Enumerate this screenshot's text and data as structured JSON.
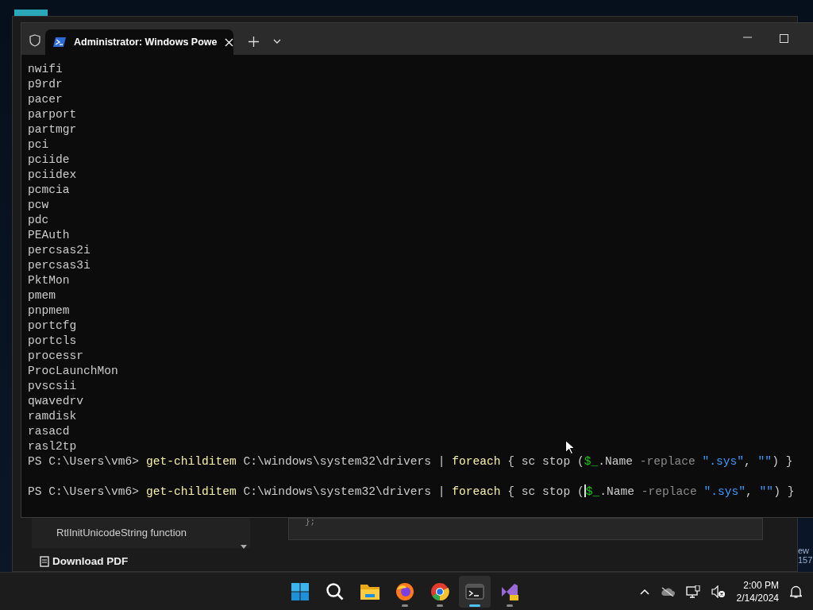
{
  "background_page": {
    "toc_item": "RtlInitUnicodeString function",
    "download_pdf": "Download PDF",
    "code_fragment": "};",
    "edge_texts": [
      "ew",
      "157"
    ]
  },
  "terminal": {
    "tabs": [
      {
        "title": "Administrator: Windows Powe",
        "selected": true
      }
    ],
    "output_lines": [
      "nwifi",
      "p9rdr",
      "pacer",
      "parport",
      "partmgr",
      "pci",
      "pciide",
      "pciidex",
      "pcmcia",
      "pcw",
      "pdc",
      "PEAuth",
      "percsas2i",
      "percsas3i",
      "PktMon",
      "pmem",
      "pnpmem",
      "portcfg",
      "portcls",
      "processr",
      "ProcLaunchMon",
      "pvscsii",
      "qwavedrv",
      "ramdisk",
      "rasacd",
      "rasl2tp"
    ],
    "prompts": [
      {
        "segments": [
          {
            "kind": "plain",
            "text": "PS C:\\Users\\vm6> "
          },
          {
            "kind": "command",
            "text": "get-childitem"
          },
          {
            "kind": "plain",
            "text": " C:\\windows\\system32\\drivers | "
          },
          {
            "kind": "command",
            "text": "foreach"
          },
          {
            "kind": "plain",
            "text": " { sc stop ("
          },
          {
            "kind": "variable",
            "text": "$_"
          },
          {
            "kind": "plain",
            "text": ".Name "
          },
          {
            "kind": "operator",
            "text": "-replace "
          },
          {
            "kind": "string",
            "text": "\".sys\""
          },
          {
            "kind": "plain",
            "text": ", "
          },
          {
            "kind": "string",
            "text": "\"\""
          },
          {
            "kind": "plain",
            "text": ") }"
          }
        ]
      },
      {
        "segments": [
          {
            "kind": "plain",
            "text": "PS C:\\Users\\vm6> "
          },
          {
            "kind": "command",
            "text": "get-childitem"
          },
          {
            "kind": "plain",
            "text": " C:\\windows\\system32\\drivers | "
          },
          {
            "kind": "command",
            "text": "foreach"
          },
          {
            "kind": "plain",
            "text": " { sc stop ("
          },
          {
            "kind": "cursor"
          },
          {
            "kind": "variable",
            "text": "$_"
          },
          {
            "kind": "plain",
            "text": ".Name "
          },
          {
            "kind": "operator",
            "text": "-replace "
          },
          {
            "kind": "string",
            "text": "\".sys\""
          },
          {
            "kind": "plain",
            "text": ", "
          },
          {
            "kind": "string",
            "text": "\"\""
          },
          {
            "kind": "plain",
            "text": ") }"
          }
        ]
      }
    ]
  },
  "taskbar": {
    "apps": [
      {
        "kind": "start",
        "active": false
      },
      {
        "kind": "search",
        "active": false
      },
      {
        "kind": "explorer",
        "active": false
      },
      {
        "kind": "firefox",
        "active": false
      },
      {
        "kind": "chrome",
        "active": false
      },
      {
        "kind": "terminal",
        "active": true
      },
      {
        "kind": "vs",
        "active": false
      }
    ],
    "clock": {
      "time": "2:00 PM",
      "date": "2/14/2024"
    }
  }
}
